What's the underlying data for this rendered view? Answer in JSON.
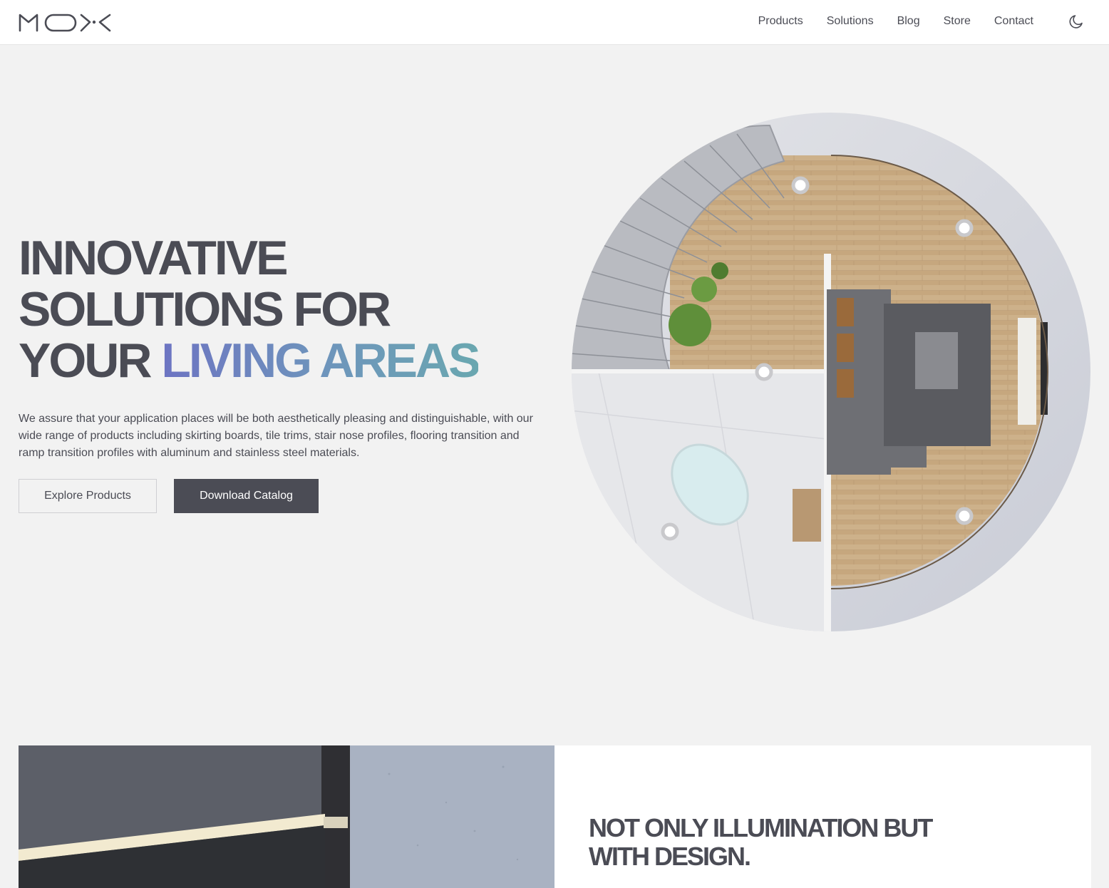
{
  "brand": {
    "logo_text": "MOXK"
  },
  "nav": {
    "items": [
      "Products",
      "Solutions",
      "Blog",
      "Store",
      "Contact"
    ],
    "theme_toggle": "moon-icon"
  },
  "hero": {
    "title_line1": "INNOVATIVE",
    "title_line2": "SOLUTIONS FOR",
    "title_line3_plain": "YOUR ",
    "title_line3_accent": "LIVING AREAS",
    "description": "We assure that your application places will be both aesthetically pleasing and distinguishable, with our wide range of products including skirting boards, tile trims, stair nose profiles, flooring transition and ramp transition profiles with aluminum and stainless steel materials.",
    "primary_button": "Explore Products",
    "secondary_button": "Download Catalog",
    "accent_gradient": [
      "#6d74c2",
      "#6e94bc",
      "#6aa7b0"
    ]
  },
  "feature": {
    "title_line1": "NOT ONLY ILLUMINATION BUT",
    "title_line2": "WITH DESIGN."
  },
  "colors": {
    "text": "#4b4c55",
    "background": "#f2f2f2",
    "button_dark": "#4b4c55"
  }
}
